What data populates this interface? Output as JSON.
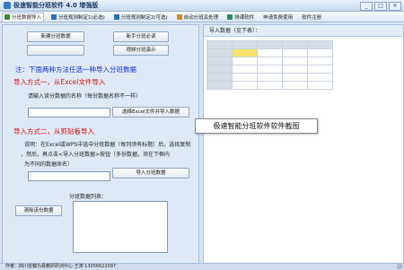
{
  "window": {
    "title": "极速智能分班软件 4.0 增强版",
    "controls": [
      "_",
      "□",
      "×"
    ]
  },
  "tabs": [
    {
      "label": "分班数据导入",
      "icon": "import-icon",
      "color": "#3a8a2a",
      "active": true
    },
    {
      "label": "分班规则制定1(必选)",
      "icon": "rule-icon",
      "color": "#2a6ac0"
    },
    {
      "label": "分班规则制定2(可选)",
      "icon": "rule2-icon",
      "color": "#2a6ac0"
    },
    {
      "label": "自动分班及处理",
      "icon": "auto-icon",
      "color": "#d08a1a"
    },
    {
      "label": "排课软件",
      "icon": "schedule-icon",
      "color": "#2a8a6a"
    },
    {
      "label": "申请免费使用",
      "icon": "",
      "color": ""
    },
    {
      "label": "软件注册",
      "icon": "",
      "color": ""
    }
  ],
  "left": {
    "buttons": {
      "new_data": "新建分班数据",
      "novice_required": "新手分班必读",
      "video_demo": "视频分班演示"
    },
    "notice": "注：下面两种方法任选一种导入分班数据",
    "method1": {
      "heading": "导入方式一，从Excel文件导入",
      "hint": "请输入读分数据的名称（每份数据名称不一样）",
      "button": "选择Excel文件并导入数据"
    },
    "method2": {
      "heading": "导入方式二，从剪贴板导入",
      "desc1": "说明：在Excel或WPS中选中分班数据（每列须有标题）后，选择复制",
      "desc2": "，然后，再点击<导入分班数据>按钮（多份数据，须在下框内",
      "desc3": "为不同的数据命名）",
      "button": "导入分班数据"
    },
    "list_label": "分班数据列表：",
    "clear_button": "清除该份数据"
  },
  "preview": {
    "title": "导入数据（见下表）："
  },
  "tooltip": "极速智能分班软件软件截图",
  "status": "作者：四川省犍为县教研研训中心 王涛  13056622097"
}
